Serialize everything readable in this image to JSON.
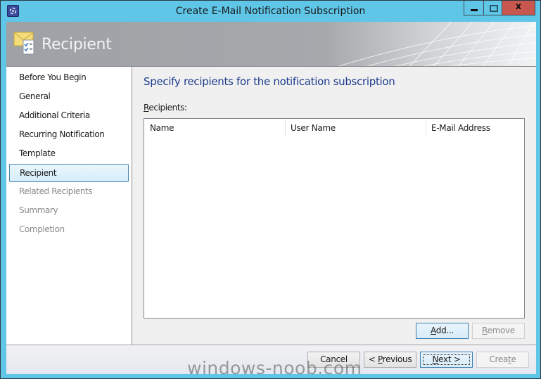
{
  "window": {
    "title": "Create E-Mail Notification Subscription",
    "app_icon": "console-app-icon",
    "controls": {
      "minimize": "minimize-icon",
      "maximize": "maximize-icon",
      "close": "x"
    }
  },
  "header": {
    "title": "Recipient",
    "icon": "mail-checklist-icon"
  },
  "nav": {
    "items": [
      {
        "label": "Before You Begin",
        "state": "normal"
      },
      {
        "label": "General",
        "state": "normal"
      },
      {
        "label": "Additional Criteria",
        "state": "normal"
      },
      {
        "label": "Recurring Notification",
        "state": "normal"
      },
      {
        "label": "Template",
        "state": "normal"
      },
      {
        "label": "Recipient",
        "state": "selected"
      },
      {
        "label": "Related Recipients",
        "state": "disabled"
      },
      {
        "label": "Summary",
        "state": "disabled"
      },
      {
        "label": "Completion",
        "state": "disabled"
      }
    ]
  },
  "main": {
    "heading": "Specify recipients for the notification subscription",
    "recipients_label_access": "R",
    "recipients_label_rest": "ecipients:",
    "columns": [
      "Name",
      "User Name",
      "E-Mail Address"
    ],
    "rows": [],
    "add_button": {
      "access": "A",
      "rest": "dd..."
    },
    "remove_button": {
      "access": "R",
      "rest": "emove"
    }
  },
  "footer": {
    "cancel": "Cancel",
    "previous": {
      "prefix": "< ",
      "access": "P",
      "rest": "revious"
    },
    "next": {
      "access": "N",
      "rest": "ext >"
    },
    "create": {
      "pre": "Crea",
      "access": "t",
      "rest": "e"
    }
  },
  "watermark": "windows-noob.com"
}
